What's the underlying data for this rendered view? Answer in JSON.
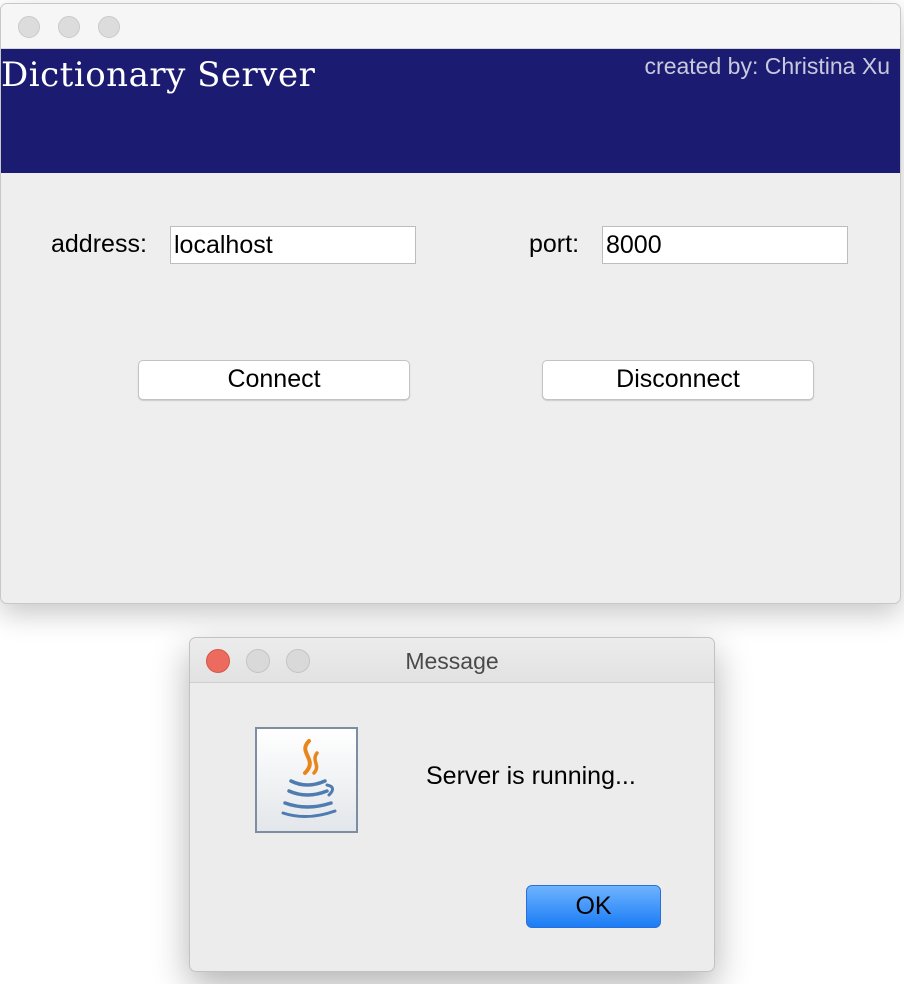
{
  "main_window": {
    "header": {
      "title": "Dictionary Server",
      "credit": "created by: Christina Xu"
    },
    "address": {
      "label": "address:",
      "value": "localhost"
    },
    "port": {
      "label": "port:",
      "value": "8000"
    },
    "buttons": {
      "connect": "Connect",
      "disconnect": "Disconnect"
    }
  },
  "dialog": {
    "title": "Message",
    "icon": "java-icon",
    "message": "Server is running...",
    "ok_label": "OK"
  },
  "colors": {
    "header_band": "#1b1b72",
    "close_red": "#ec6a5e",
    "ok_blue": "#1a7cf5"
  }
}
